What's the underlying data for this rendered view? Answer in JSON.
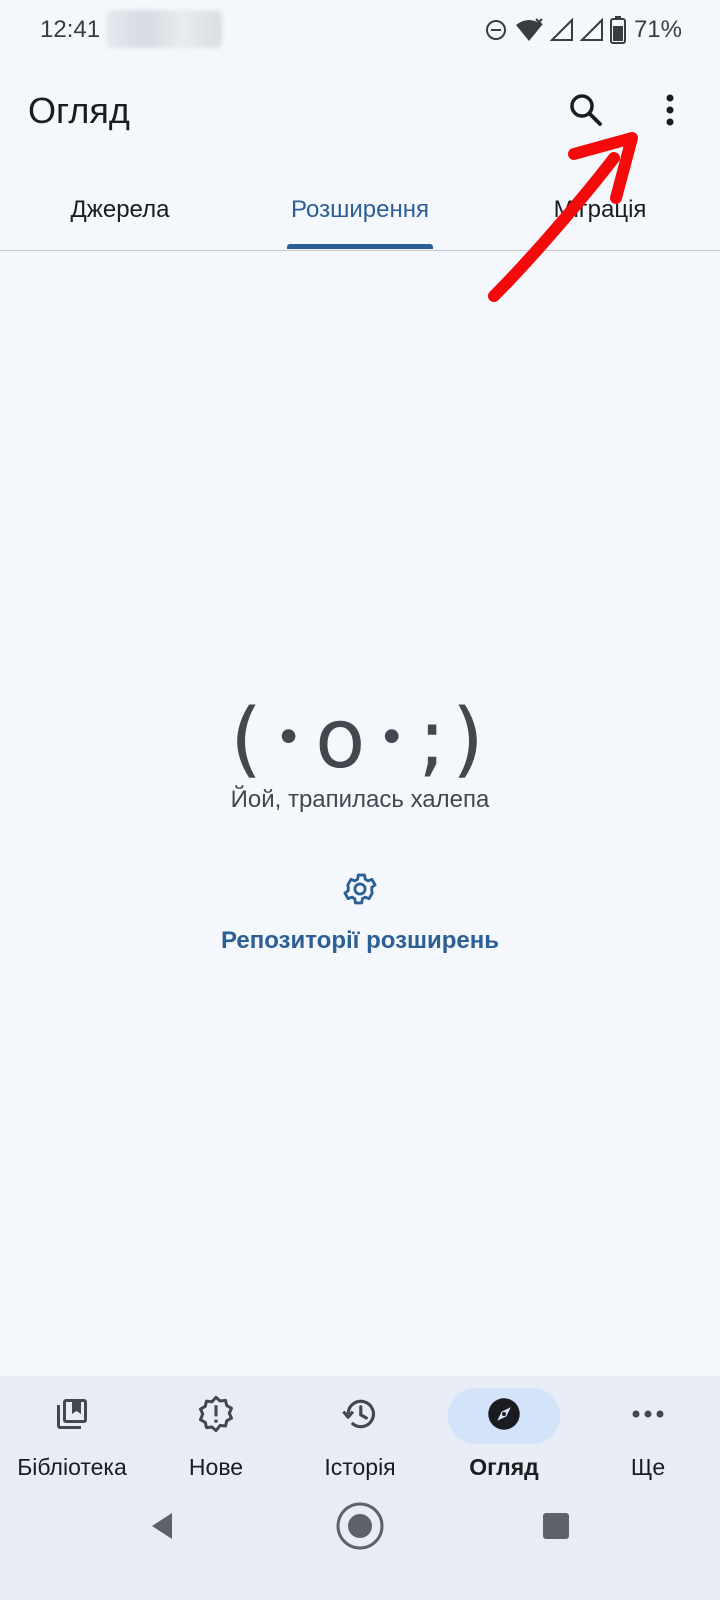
{
  "status_bar": {
    "time": "12:41",
    "battery_percent": "71%",
    "icons": [
      "do-not-disturb-icon",
      "wifi-icon",
      "signal-icon",
      "signal-icon",
      "battery-icon"
    ]
  },
  "app_bar": {
    "title": "Огляд",
    "actions": [
      "search-icon",
      "more-vert-icon"
    ]
  },
  "tabs": [
    {
      "label": "Джерела",
      "selected": false
    },
    {
      "label": "Розширення",
      "selected": true
    },
    {
      "label": "Міграція",
      "selected": false
    }
  ],
  "empty_state": {
    "face": "(･o･;)",
    "message": "Йой, трапилась халепа",
    "action_icon": "gear-icon",
    "action_label": "Репозиторії розширень"
  },
  "annotation": {
    "type": "red-arrow-icon",
    "color": "#f40a0a"
  },
  "bottom_nav": [
    {
      "label": "Бібліотека",
      "icon": "library-icon",
      "active": false
    },
    {
      "label": "Нове",
      "icon": "updates-badge-icon",
      "active": false
    },
    {
      "label": "Історія",
      "icon": "history-icon",
      "active": false
    },
    {
      "label": "Огляд",
      "icon": "compass-icon",
      "active": true
    },
    {
      "label": "Ще",
      "icon": "more-horiz-icon",
      "active": false
    }
  ],
  "system_nav": [
    "back-icon",
    "home-icon",
    "recents-icon"
  ],
  "colors": {
    "accent": "#2c5f94",
    "background": "#f4f8fd",
    "nav_bg": "#e8edf5",
    "active_pill": "#d2e3fa"
  }
}
